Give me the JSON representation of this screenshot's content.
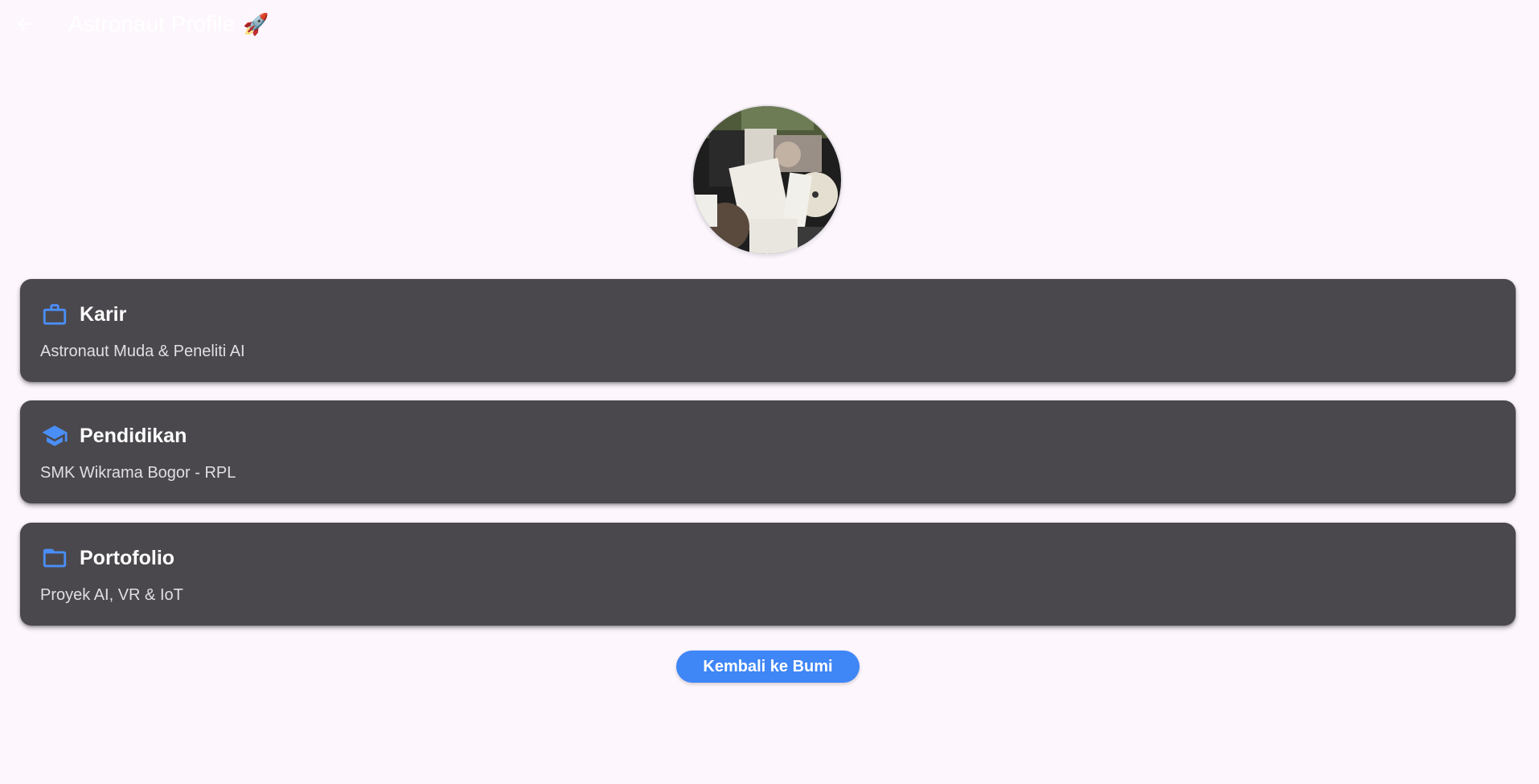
{
  "appbar": {
    "title": "Astronaut Profile",
    "title_emoji": "🚀",
    "back_icon": "arrow-back-icon"
  },
  "avatar": {
    "alt": "profile-photo"
  },
  "cards": [
    {
      "icon": "briefcase-icon",
      "title": "Karir",
      "subtitle": "Astronaut Muda & Peneliti AI"
    },
    {
      "icon": "graduation-cap-icon",
      "title": "Pendidikan",
      "subtitle": "SMK Wikrama Bogor - RPL"
    },
    {
      "icon": "folder-icon",
      "title": "Portofolio",
      "subtitle": "Proyek AI, VR & IoT"
    }
  ],
  "action": {
    "label": "Kembali ke Bumi"
  },
  "colors": {
    "background": "#fdf6fd",
    "card": "#4a484c",
    "accent": "#3f86f6",
    "icon": "#4a8ef7"
  }
}
